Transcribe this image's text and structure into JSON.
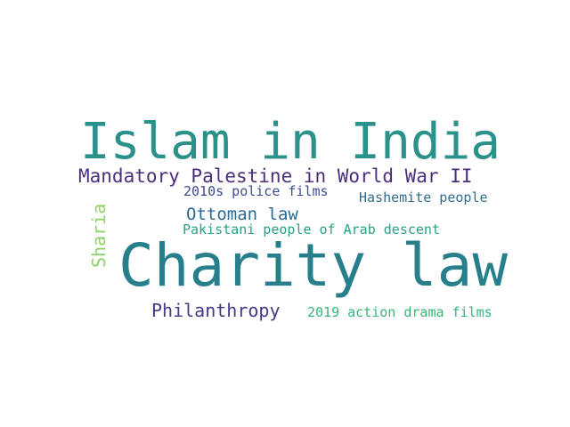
{
  "wordcloud": {
    "words": [
      {
        "text": "Islam in India",
        "color": "#2a918b"
      },
      {
        "text": "Mandatory Palestine in World War II",
        "color": "#4b2f7c"
      },
      {
        "text": "2010s police films",
        "color": "#3f4b8a"
      },
      {
        "text": "Hashemite people",
        "color": "#2f6d8e"
      },
      {
        "text": "Ottoman law",
        "color": "#2a6a8f"
      },
      {
        "text": "Pakistani people of Arab descent",
        "color": "#2aa184"
      },
      {
        "text": "Sharia",
        "color": "#8ed26a"
      },
      {
        "text": "Charity law",
        "color": "#287f8c"
      },
      {
        "text": "Philanthropy",
        "color": "#433a87"
      },
      {
        "text": "2019 action drama films",
        "color": "#35b779"
      }
    ]
  }
}
